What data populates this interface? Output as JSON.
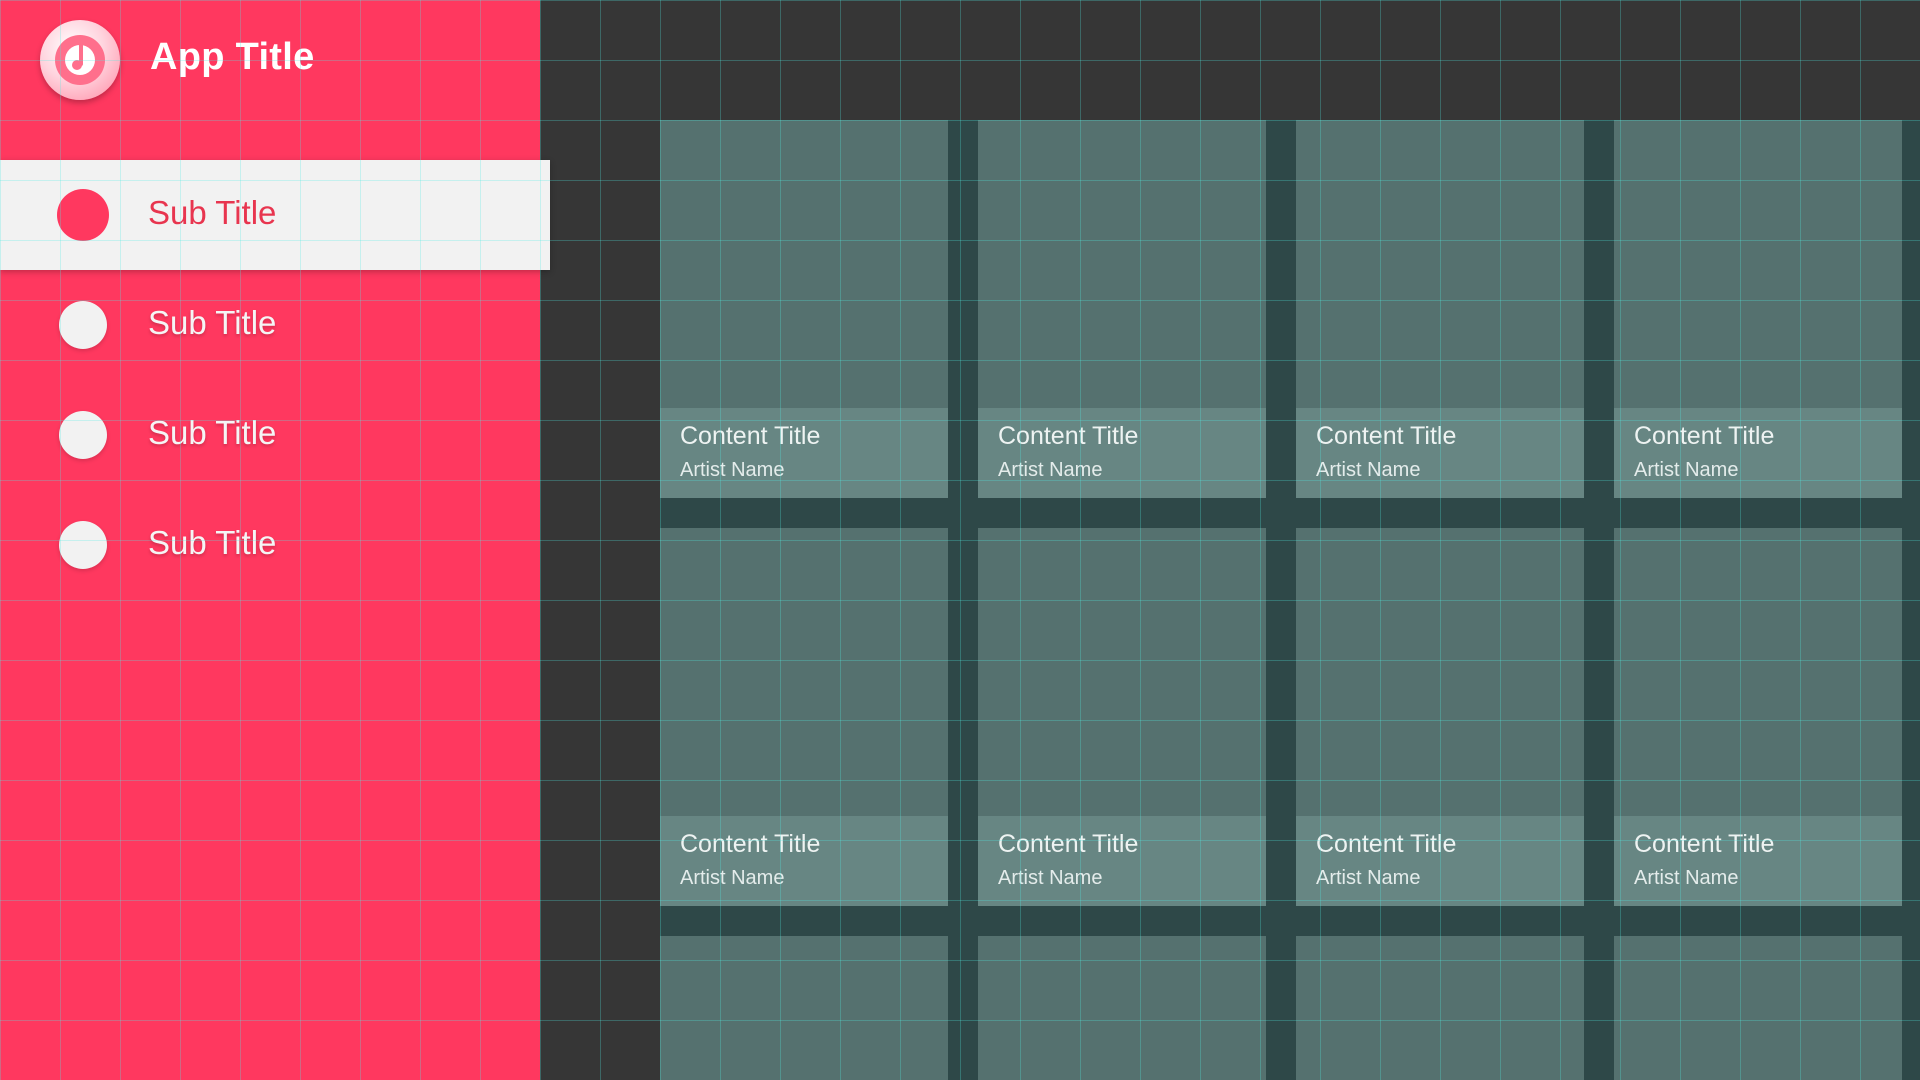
{
  "app": {
    "title": "App Title",
    "logo_icon": "music-note-icon"
  },
  "colors": {
    "accent": "#FF385F",
    "content_background": "#363636",
    "card": "#55716F",
    "card_info": "#678683",
    "selected_nav": "#F2F2F2"
  },
  "sidebar": {
    "items": [
      {
        "label": "Sub Title",
        "selected": true
      },
      {
        "label": "Sub Title",
        "selected": false
      },
      {
        "label": "Sub Title",
        "selected": false
      },
      {
        "label": "Sub Title",
        "selected": false
      }
    ]
  },
  "grid": {
    "cards": [
      {
        "title": "Content Title",
        "artist": "Artist Name"
      },
      {
        "title": "Content Title",
        "artist": "Artist Name"
      },
      {
        "title": "Content Title",
        "artist": "Artist Name"
      },
      {
        "title": "Content Title",
        "artist": "Artist Name"
      },
      {
        "title": "Content Title",
        "artist": "Artist Name"
      },
      {
        "title": "Content Title",
        "artist": "Artist Name"
      },
      {
        "title": "Content Title",
        "artist": "Artist Name"
      },
      {
        "title": "Content Title",
        "artist": "Artist Name"
      }
    ]
  }
}
